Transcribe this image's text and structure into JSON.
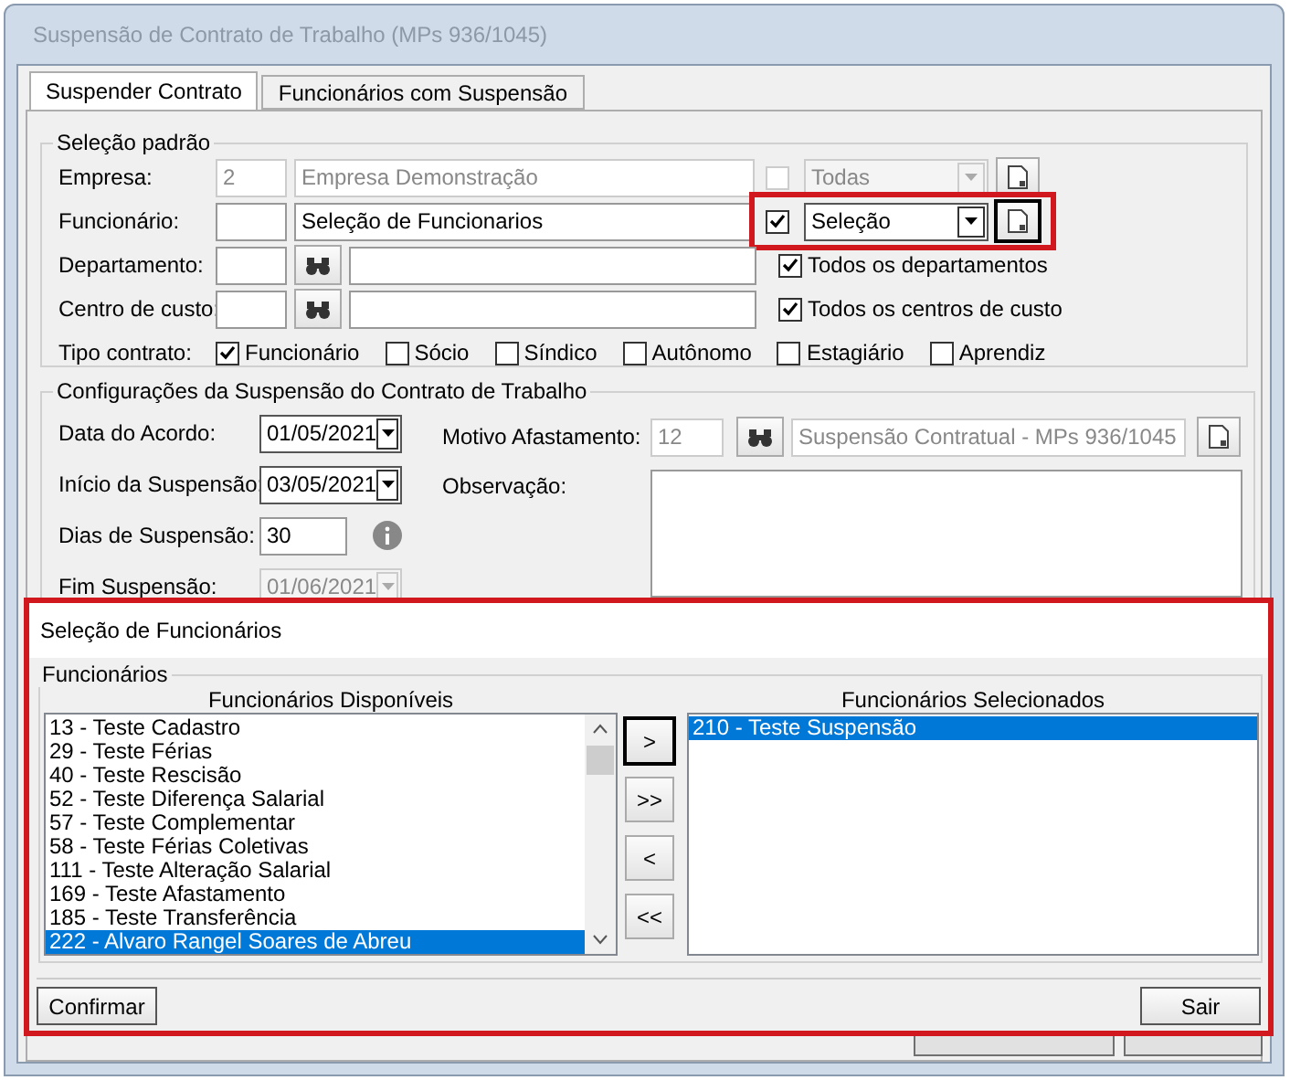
{
  "window": {
    "title": "Suspensão de Contrato de Trabalho (MPs 936/1045)"
  },
  "tabs": [
    {
      "label": "Suspender Contrato",
      "selected": true
    },
    {
      "label": "Funcionários com Suspensão",
      "selected": false
    }
  ],
  "selecao_padrao": {
    "legend": "Seleção padrão",
    "rows": [
      {
        "kind": "picker",
        "label": "Empresa:",
        "code": "2",
        "value": "Empresa Demonstração",
        "disabled": true,
        "checked": false,
        "combo": "Todas",
        "highlighted": false
      },
      {
        "kind": "picker",
        "label": "Funcionário:",
        "code": "",
        "value": "Seleção de Funcionarios",
        "disabled": false,
        "checked": true,
        "combo": "Seleção",
        "highlighted": true
      },
      {
        "kind": "search",
        "label": "Departamento:",
        "checked": true,
        "check_label": "Todos os departamentos"
      },
      {
        "kind": "search",
        "label": "Centro de custo:",
        "checked": true,
        "check_label": "Todos os centros de custo"
      }
    ],
    "tipo_contrato": {
      "label": "Tipo contrato:",
      "options": [
        {
          "label": "Funcionário",
          "checked": true
        },
        {
          "label": "Sócio",
          "checked": false
        },
        {
          "label": "Síndico",
          "checked": false
        },
        {
          "label": "Autônomo",
          "checked": false
        },
        {
          "label": "Estagiário",
          "checked": false
        },
        {
          "label": "Aprendiz",
          "checked": false
        }
      ]
    }
  },
  "configuracoes": {
    "legend": "Configurações da Suspensão do Contrato de Trabalho",
    "fields": [
      {
        "kind": "date",
        "label": "Data do Acordo:",
        "value": "01/05/2021",
        "disabled": false
      },
      {
        "kind": "date",
        "label": "Início da Suspensão:",
        "value": "03/05/2021",
        "disabled": false
      },
      {
        "kind": "number",
        "label": "Dias de Suspensão:",
        "value": "30",
        "disabled": false
      },
      {
        "kind": "date",
        "label": "Fim Suspensão:",
        "value": "01/06/2021",
        "disabled": true
      }
    ],
    "motivo": {
      "label": "Motivo Afastamento:",
      "code": "12",
      "value": "Suspensão Contratual - MPs 936/1045"
    },
    "observacao": {
      "label": "Observação:"
    }
  },
  "dialog": {
    "title": "Seleção de Funcionários",
    "legend": "Funcionários",
    "available": {
      "heading": "Funcionários Disponíveis",
      "items": [
        {
          "label": "13 - Teste Cadastro",
          "selected": false
        },
        {
          "label": "29 - Teste Férias",
          "selected": false
        },
        {
          "label": "40 - Teste Rescisão",
          "selected": false
        },
        {
          "label": "52 - Teste Diferença Salarial",
          "selected": false
        },
        {
          "label": "57 - Teste Complementar",
          "selected": false
        },
        {
          "label": "58 - Teste Férias Coletivas",
          "selected": false
        },
        {
          "label": "111 - Teste Alteração Salarial",
          "selected": false
        },
        {
          "label": "169 - Teste Afastamento",
          "selected": false
        },
        {
          "label": "185 - Teste Transferência",
          "selected": false
        },
        {
          "label": "222 - Alvaro Rangel Soares de Abreu",
          "selected": true
        }
      ]
    },
    "move_buttons": [
      ">",
      ">>",
      "<",
      "<<"
    ],
    "chosen": {
      "heading": "Funcionários Selecionados",
      "items": [
        {
          "label": "210 - Teste Suspensão",
          "selected": true
        }
      ]
    },
    "buttons": [
      "Confirmar",
      "Sair"
    ]
  }
}
